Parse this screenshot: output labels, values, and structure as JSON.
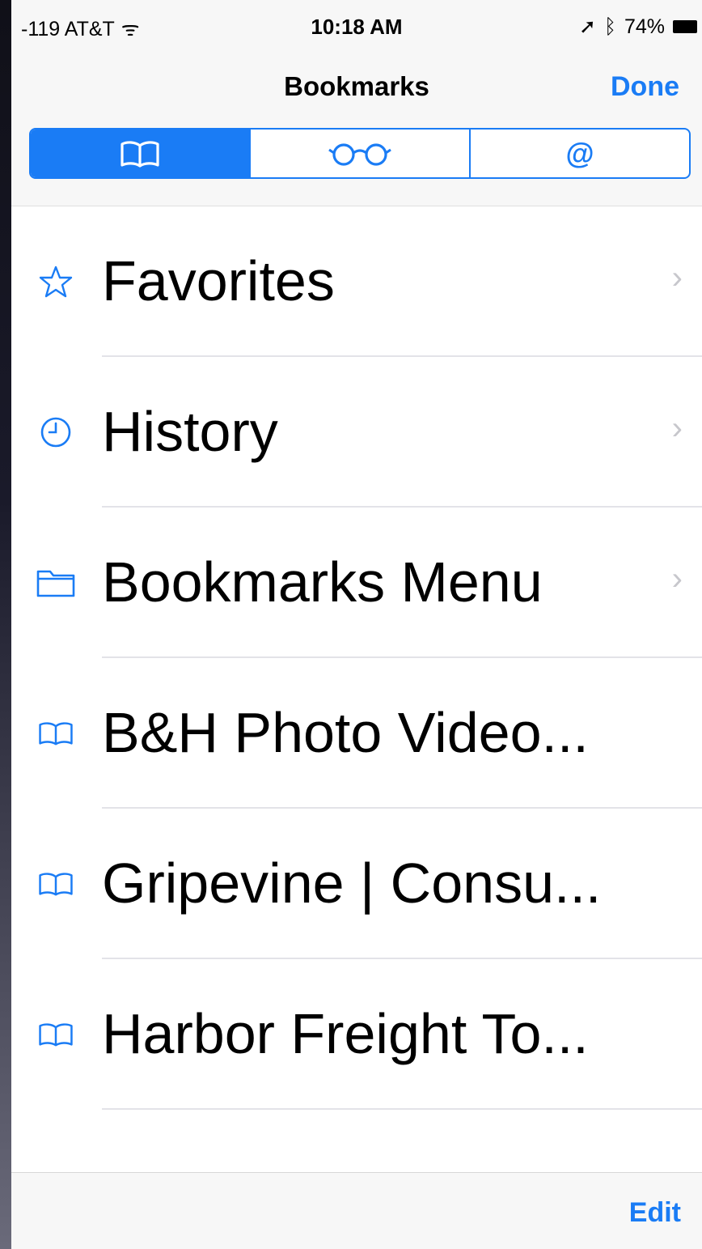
{
  "status_bar": {
    "carrier": "-119 AT&T",
    "time": "10:18 AM",
    "battery_percent": "74%"
  },
  "nav": {
    "title": "Bookmarks",
    "done_label": "Done"
  },
  "segments": [
    {
      "icon": "book-icon",
      "active": true
    },
    {
      "icon": "glasses-icon",
      "active": false
    },
    {
      "icon": "at-symbol-icon",
      "glyph": "@",
      "active": false
    }
  ],
  "list": {
    "items": [
      {
        "label": "Favorites",
        "icon": "star-icon",
        "chevron": true
      },
      {
        "label": "History",
        "icon": "clock-icon",
        "chevron": true
      },
      {
        "label": "Bookmarks Menu",
        "icon": "folder-icon",
        "chevron": true
      },
      {
        "label": "B&H Photo Video...",
        "icon": "book-icon",
        "chevron": false
      },
      {
        "label": "Gripevine | Consu...",
        "icon": "book-icon",
        "chevron": false
      },
      {
        "label": "Harbor Freight To...",
        "icon": "book-icon",
        "chevron": false
      }
    ]
  },
  "toolbar": {
    "edit_label": "Edit"
  },
  "colors": {
    "accent": "#1a7cf5",
    "separator": "#e3e3e8",
    "bar_background": "#f7f7f7"
  }
}
